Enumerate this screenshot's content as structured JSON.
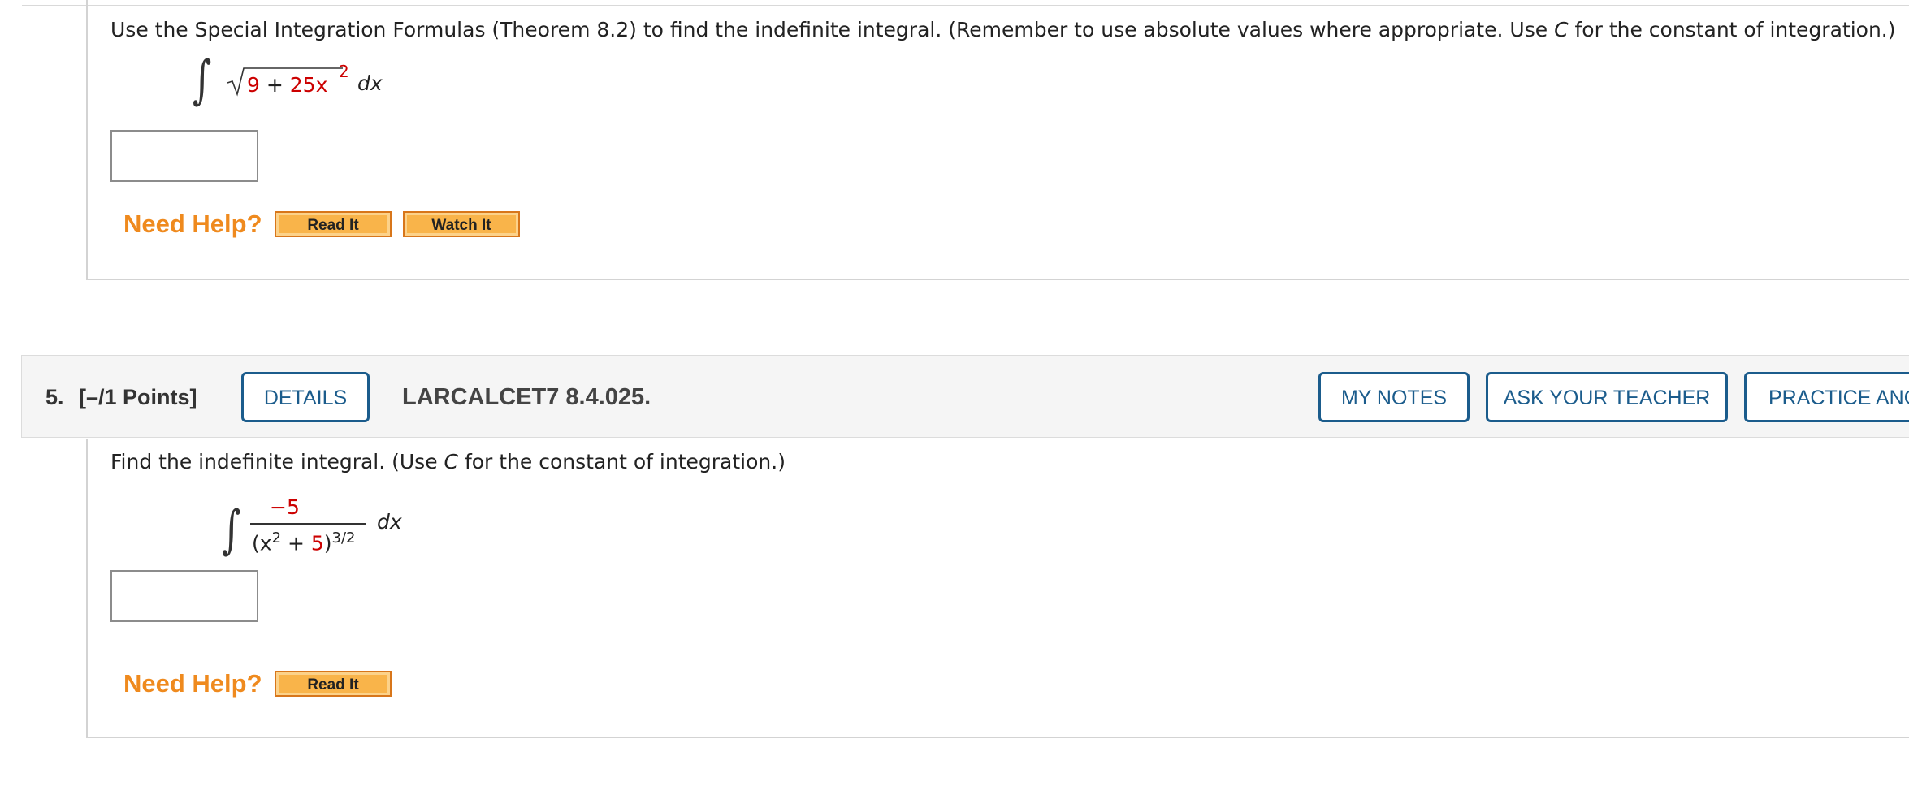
{
  "question4": {
    "prompt_parts": [
      "Use the Special Integration Formulas (Theorem 8.2) to find the indefinite integral. (Remember to use absolute values where appropriate. Use ",
      "C",
      " for the constant of integration.)"
    ],
    "integrand": {
      "radicand_const": "9",
      "plus": "+",
      "radicand_coef": "25x",
      "exp": "2",
      "dx": "dx"
    },
    "need_help": "Need Help?",
    "read_it": "Read It",
    "watch_it": "Watch It"
  },
  "question5": {
    "number": "5.",
    "points": "[–/1 Points]",
    "details_button": "DETAILS",
    "code": "LARCALCET7 8.4.025.",
    "my_notes_button": "MY NOTES",
    "ask_teacher_button": "ASK YOUR TEACHER",
    "practice_button": "PRACTICE ANOTHER",
    "prompt_parts": [
      "Find the indefinite integral. (Use ",
      "C",
      " for the constant of integration.)"
    ],
    "integrand": {
      "numerator": "−5",
      "den_open": "(x",
      "den_exp": "2",
      "den_plus": " + ",
      "den_const": "5",
      "den_close": ")",
      "den_power": "3/2",
      "dx": "dx"
    },
    "need_help": "Need Help?",
    "read_it": "Read It"
  }
}
